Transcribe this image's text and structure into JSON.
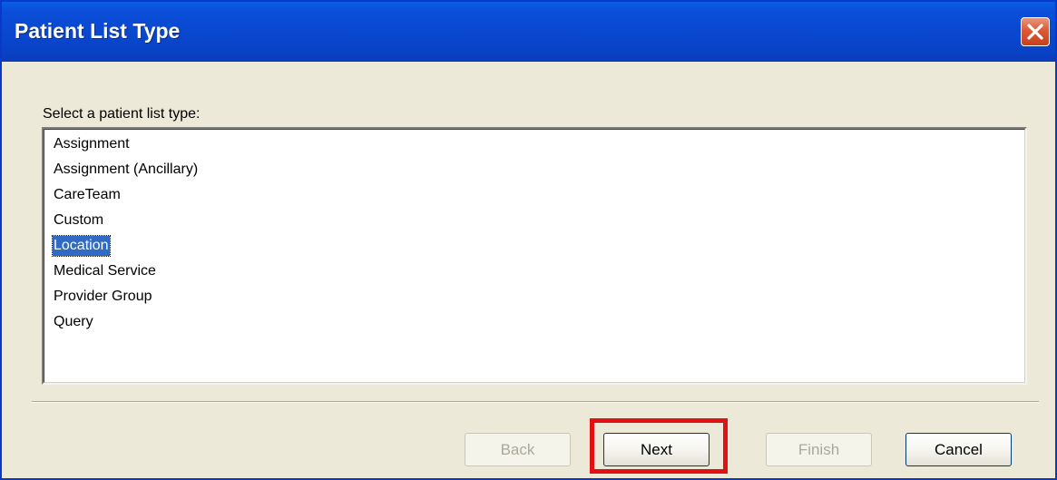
{
  "window": {
    "title": "Patient List Type"
  },
  "prompt": "Select a patient list type:",
  "list": {
    "items": [
      {
        "label": "Assignment",
        "selected": false
      },
      {
        "label": "Assignment (Ancillary)",
        "selected": false
      },
      {
        "label": "CareTeam",
        "selected": false
      },
      {
        "label": "Custom",
        "selected": false
      },
      {
        "label": "Location",
        "selected": true
      },
      {
        "label": "Medical Service",
        "selected": false
      },
      {
        "label": "Provider Group",
        "selected": false
      },
      {
        "label": "Query",
        "selected": false
      }
    ]
  },
  "buttons": {
    "back": {
      "label": "Back",
      "enabled": false
    },
    "next": {
      "label": "Next",
      "enabled": true
    },
    "finish": {
      "label": "Finish",
      "enabled": false
    },
    "cancel": {
      "label": "Cancel",
      "enabled": true
    }
  },
  "icons": {
    "close": "close-icon"
  },
  "colors": {
    "titlebar": "#0a47cf",
    "selection": "#316ac5",
    "highlight": "#e41114",
    "dialog_bg": "#ece9d8"
  }
}
